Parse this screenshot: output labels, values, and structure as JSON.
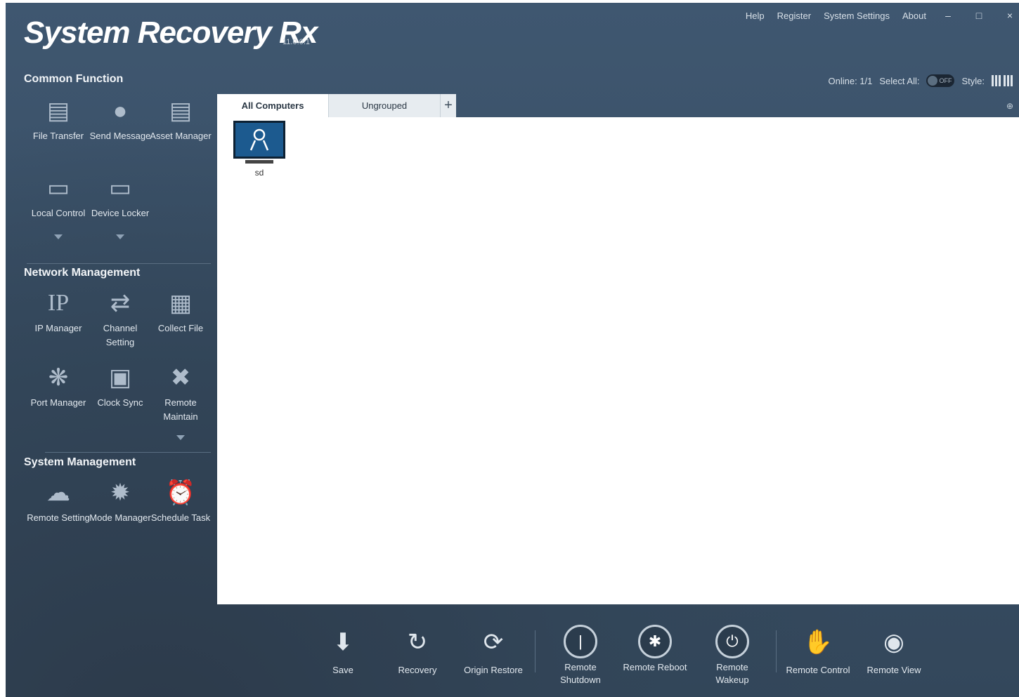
{
  "app": {
    "title": "System Recovery Rx",
    "version": "11.0.0.1"
  },
  "topmenu": {
    "help": "Help",
    "register": "Register",
    "system_settings": "System Settings",
    "about": "About",
    "minimize": "–",
    "maximize": "□",
    "close": "×"
  },
  "toolbar": {
    "online": "Online: 1/1",
    "select_all": "Select All:",
    "toggle": "OFF",
    "style": "Style:"
  },
  "sidebar": {
    "common_function": {
      "title": "Common Function",
      "items": [
        {
          "label": "File Transfer",
          "icon": "folder-icon"
        },
        {
          "label": "Send Message",
          "icon": "chat-bubble-icon"
        },
        {
          "label": "Asset Manager",
          "icon": "clipboard-icon"
        },
        {
          "label": "Local Control",
          "icon": "monitor-icon"
        },
        {
          "label": "Device Locker",
          "icon": "monitor-lock-icon"
        }
      ]
    },
    "network_management": {
      "title": "Network Management",
      "items": [
        {
          "label": "IP Manager",
          "icon": "ip-icon"
        },
        {
          "label": "Channel Setting",
          "icon": "shuffle-icon"
        },
        {
          "label": "Collect File",
          "icon": "files-icon"
        },
        {
          "label": "Port Manager",
          "icon": "atom-icon"
        },
        {
          "label": "Clock Sync",
          "icon": "calendar-icon"
        },
        {
          "label": "Remote Maintain",
          "icon": "tools-icon"
        }
      ]
    },
    "system_management": {
      "title": "System Management",
      "items": [
        {
          "label": "Remote Setting",
          "icon": "cloud-icon"
        },
        {
          "label": "Mode Manager",
          "icon": "gear-star-icon"
        },
        {
          "label": "Schedule Task",
          "icon": "alarm-clock-icon"
        }
      ]
    }
  },
  "tabs": [
    {
      "label": "All Computers"
    },
    {
      "label": "Ungrouped"
    }
  ],
  "tab_add": "+",
  "computers": [
    {
      "name": "sd"
    }
  ],
  "bottombar": [
    {
      "label": "Save",
      "icon": "download-icon"
    },
    {
      "label": "Recovery",
      "icon": "refresh-icon"
    },
    {
      "label": "Origin Restore",
      "icon": "restore-icon"
    },
    {
      "label": "Remote Shutdown",
      "icon": "shutdown-icon"
    },
    {
      "label": "Remote Reboot",
      "icon": "reboot-icon"
    },
    {
      "label": "Remote Wakeup",
      "icon": "power-icon"
    },
    {
      "label": "Remote Control",
      "icon": "hand-icon"
    },
    {
      "label": "Remote View",
      "icon": "eye-icon"
    }
  ],
  "colors": {
    "accent_blue": "#1c5a8f",
    "background": "#3a5067",
    "content": "#ffffff"
  }
}
